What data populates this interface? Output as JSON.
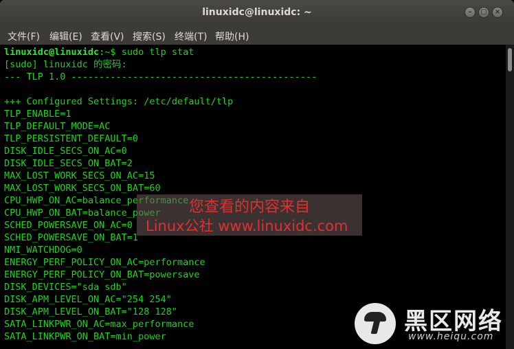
{
  "window": {
    "title": "linuxidc@linuxidc: ~",
    "buttons": {
      "minimize": "–",
      "maximize": "□",
      "close": "×"
    }
  },
  "menubar": {
    "items": [
      "文件(F)",
      "编辑(E)",
      "查看(V)",
      "搜索(S)",
      "终端(T)",
      "帮助(H)"
    ]
  },
  "terminal": {
    "prompt_user": "linuxidc@linuxidc",
    "prompt_path": ":~$",
    "command": " sudo tlp stat",
    "lines": [
      "[sudo] linuxidc 的密码:",
      "--- TLP 1.0 --------------------------------------------",
      "",
      "+++ Configured Settings: /etc/default/tlp",
      "TLP_ENABLE=1",
      "TLP_DEFAULT_MODE=AC",
      "TLP_PERSISTENT_DEFAULT=0",
      "DISK_IDLE_SECS_ON_AC=0",
      "DISK_IDLE_SECS_ON_BAT=2",
      "MAX_LOST_WORK_SECS_ON_AC=15",
      "MAX_LOST_WORK_SECS_ON_BAT=60",
      "CPU_HWP_ON_AC=balance_performance",
      "CPU_HWP_ON_BAT=balance_power",
      "SCHED_POWERSAVE_ON_AC=0",
      "SCHED_POWERSAVE_ON_BAT=1",
      "NMI_WATCHDOG=0",
      "ENERGY_PERF_POLICY_ON_AC=performance",
      "ENERGY_PERF_POLICY_ON_BAT=powersave",
      "DISK_DEVICES=\"sda sdb\"",
      "DISK_APM_LEVEL_ON_AC=\"254 254\"",
      "DISK_APM_LEVEL_ON_BAT=\"128 128\"",
      "SATA_LINKPWR_ON_AC=max_performance",
      "SATA_LINKPWR_ON_BAT=min_power"
    ]
  },
  "watermark": {
    "line1": "您查看的内容来自",
    "line2": "Linux公社 www.linuxidc.com"
  },
  "logo": {
    "name": "黑区网络",
    "url": "www.heiqu.com"
  }
}
